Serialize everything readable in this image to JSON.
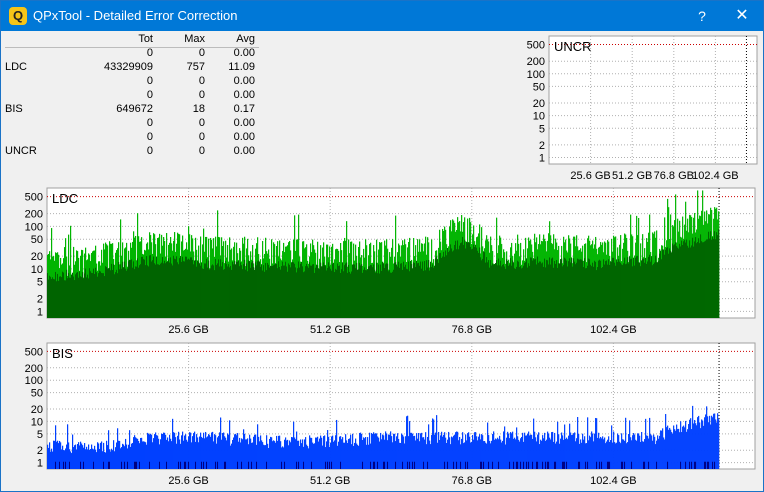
{
  "window": {
    "title": "QPxTool - Detailed Error Correction",
    "app_icon": "Q",
    "help_glyph": "?",
    "close_glyph": "✕"
  },
  "stats": {
    "headers": [
      "Tot",
      "Max",
      "Avg"
    ],
    "rows": [
      {
        "label": "",
        "tot": "0",
        "max": "0",
        "avg": "0.00"
      },
      {
        "label": "LDC",
        "tot": "43329909",
        "max": "757",
        "avg": "11.09"
      },
      {
        "label": "",
        "tot": "0",
        "max": "0",
        "avg": "0.00"
      },
      {
        "label": "",
        "tot": "0",
        "max": "0",
        "avg": "0.00"
      },
      {
        "label": "BIS",
        "tot": "649672",
        "max": "18",
        "avg": "0.17"
      },
      {
        "label": "",
        "tot": "0",
        "max": "0",
        "avg": "0.00"
      },
      {
        "label": "",
        "tot": "0",
        "max": "0",
        "avg": "0.00"
      },
      {
        "label": "UNCR",
        "tot": "0",
        "max": "0",
        "avg": "0.00"
      }
    ]
  },
  "chart_data": [
    {
      "id": "uncr",
      "type": "bar",
      "title": "UNCR",
      "y_scale": "log",
      "y_ticks": [
        "500",
        "200",
        "100",
        "50",
        "20",
        "10",
        "5",
        "2",
        "1"
      ],
      "x_ticks": [
        "25.6 GB",
        "51.2 GB",
        "76.8 GB",
        "102.4 GB"
      ],
      "x_range": [
        0,
        128
      ],
      "end_marker_gb": 121.5,
      "colors": {
        "bar": "#0000ff",
        "threshold": "#cc0000"
      },
      "values": []
    },
    {
      "id": "ldc",
      "type": "bar",
      "title": "LDC",
      "y_scale": "log",
      "y_ticks": [
        "500",
        "200",
        "100",
        "50",
        "20",
        "10",
        "5",
        "2",
        "1"
      ],
      "x_ticks": [
        "25.6 GB",
        "51.2 GB",
        "76.8 GB",
        "102.4 GB"
      ],
      "x_range": [
        0,
        128
      ],
      "end_marker_gb": 121.5,
      "colors": {
        "bar": "#00b400",
        "avg": "#006400",
        "threshold": "#cc0000"
      },
      "series": [
        {
          "x": [
            0,
            10,
            20,
            30,
            40,
            50,
            60,
            70,
            75,
            80,
            90,
            100,
            110,
            121
          ],
          "values": [
            30,
            40,
            80,
            60,
            55,
            50,
            50,
            60,
            200,
            60,
            70,
            60,
            80,
            300
          ]
        }
      ]
    },
    {
      "id": "bis",
      "type": "bar",
      "title": "BIS",
      "y_scale": "log",
      "y_ticks": [
        "500",
        "200",
        "100",
        "50",
        "20",
        "10",
        "5",
        "2",
        "1"
      ],
      "x_ticks": [
        "25.6 GB",
        "51.2 GB",
        "76.8 GB",
        "102.4 GB"
      ],
      "x_range": [
        0,
        128
      ],
      "end_marker_gb": 121.5,
      "colors": {
        "bar": "#0040ff",
        "low": "#000080",
        "threshold": "#cc0000"
      },
      "series": [
        {
          "x": [
            0,
            10,
            20,
            30,
            40,
            50,
            60,
            70,
            80,
            90,
            100,
            110,
            121
          ],
          "values": [
            3,
            3,
            5,
            5,
            4,
            4,
            5,
            5,
            5,
            5,
            5,
            5,
            15
          ]
        }
      ]
    }
  ]
}
